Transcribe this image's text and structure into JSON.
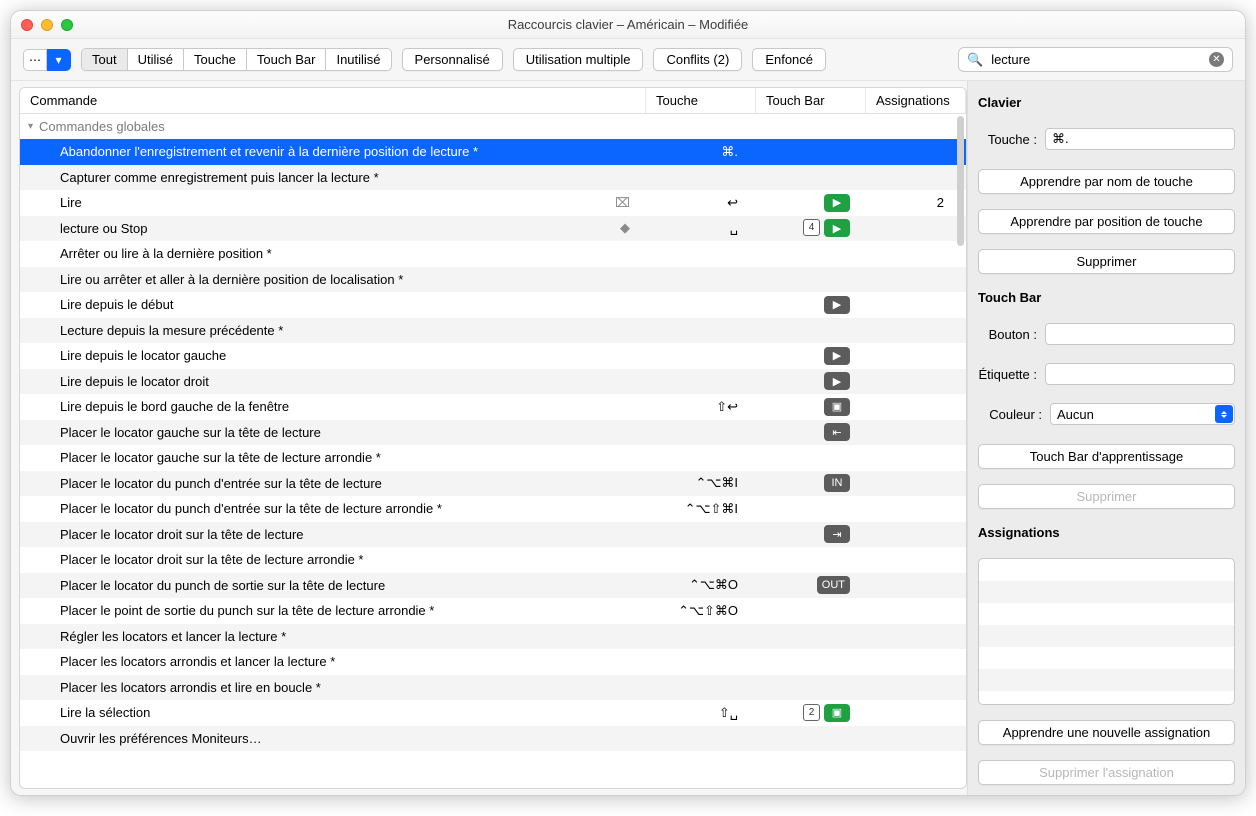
{
  "window": {
    "title": "Raccourcis clavier – Américain – Modifiée"
  },
  "toolbar": {
    "filters": [
      "Tout",
      "Utilisé",
      "Touche",
      "Touch Bar",
      "Inutilisé"
    ],
    "active_filter": 0,
    "buttons": {
      "customized": "Personnalisé",
      "multiuse": "Utilisation multiple",
      "conflicts": "Conflits (2)",
      "pressed": "Enfoncé"
    }
  },
  "search": {
    "placeholder": "",
    "value": "lecture"
  },
  "columns": {
    "command": "Commande",
    "key": "Touche",
    "touchbar": "Touch Bar",
    "assignments": "Assignations"
  },
  "group": "Commandes globales",
  "rows": [
    {
      "name": "Abandonner l'enregistrement et revenir à la dernière position de lecture *",
      "key": "⌘.",
      "tb": [],
      "asg": "",
      "selected": true
    },
    {
      "name": "Capturer comme enregistrement puis lancer la lecture *",
      "key": "",
      "tb": [],
      "asg": ""
    },
    {
      "name": "Lire",
      "extra_glyphs": [
        "⌧"
      ],
      "key": "↩",
      "tb": [
        {
          "t": "play"
        }
      ],
      "asg": "2"
    },
    {
      "name": "lecture ou Stop",
      "extra_glyphs": [
        "◆"
      ],
      "key": "␣",
      "tb": [
        {
          "t": "num",
          "v": "4"
        },
        {
          "t": "play"
        }
      ],
      "asg": ""
    },
    {
      "name": "Arrêter ou lire à la dernière position *",
      "key": "",
      "tb": [],
      "asg": ""
    },
    {
      "name": "Lire ou arrêter et aller à la dernière position de localisation *",
      "key": "",
      "tb": [],
      "asg": ""
    },
    {
      "name": "Lire depuis le début",
      "key": "",
      "tb": [
        {
          "t": "dark",
          "v": "▶"
        }
      ],
      "asg": ""
    },
    {
      "name": "Lecture depuis la mesure précédente *",
      "key": "",
      "tb": [],
      "asg": ""
    },
    {
      "name": "Lire depuis le locator gauche",
      "key": "",
      "tb": [
        {
          "t": "dark",
          "v": "▶"
        }
      ],
      "asg": ""
    },
    {
      "name": "Lire depuis le locator droit",
      "key": "",
      "tb": [
        {
          "t": "dark",
          "v": "▶"
        }
      ],
      "asg": ""
    },
    {
      "name": "Lire depuis le bord gauche de la fenêtre",
      "key": "⇧↩",
      "tb": [
        {
          "t": "dark",
          "v": "▣"
        }
      ],
      "asg": ""
    },
    {
      "name": "Placer le locator gauche sur la tête de lecture",
      "key": "",
      "tb": [
        {
          "t": "dark",
          "v": "⇤"
        }
      ],
      "asg": ""
    },
    {
      "name": "Placer le locator gauche sur la tête de lecture arrondie *",
      "key": "",
      "tb": [],
      "asg": ""
    },
    {
      "name": "Placer le locator du punch d'entrée sur la tête de lecture",
      "key": "⌃⌥⌘I",
      "tb": [
        {
          "t": "dark",
          "v": "IN"
        }
      ],
      "asg": ""
    },
    {
      "name": "Placer le locator du punch d'entrée sur la tête de lecture arrondie *",
      "key": "⌃⌥⇧⌘I",
      "tb": [],
      "asg": ""
    },
    {
      "name": "Placer le locator droit sur la tête de lecture",
      "key": "",
      "tb": [
        {
          "t": "dark",
          "v": "⇥"
        }
      ],
      "asg": ""
    },
    {
      "name": "Placer le locator droit sur la tête de lecture arrondie *",
      "key": "",
      "tb": [],
      "asg": ""
    },
    {
      "name": "Placer le locator du punch de sortie sur la tête de lecture",
      "key": "⌃⌥⌘O",
      "tb": [
        {
          "t": "dark",
          "v": "OUT"
        }
      ],
      "asg": ""
    },
    {
      "name": "Placer le point de sortie du punch sur la tête de lecture arrondie *",
      "key": "⌃⌥⇧⌘O",
      "tb": [],
      "asg": ""
    },
    {
      "name": "Régler les locators et lancer la lecture *",
      "key": "",
      "tb": [],
      "asg": ""
    },
    {
      "name": "Placer les locators arrondis et lancer la lecture *",
      "key": "",
      "tb": [],
      "asg": ""
    },
    {
      "name": "Placer les locators arrondis et lire en boucle *",
      "key": "",
      "tb": [],
      "asg": ""
    },
    {
      "name": "Lire la sélection",
      "key": "⇧␣",
      "tb": [
        {
          "t": "num",
          "v": "2"
        },
        {
          "t": "play",
          "v": "▣"
        }
      ],
      "asg": ""
    },
    {
      "name": "Ouvrir les préférences Moniteurs…",
      "key": "",
      "tb": [],
      "asg": ""
    }
  ],
  "side": {
    "kb_header": "Clavier",
    "kb_key_label": "Touche :",
    "kb_key_value": "⌘.",
    "learn_name": "Apprendre par nom de touche",
    "learn_pos": "Apprendre par position de touche",
    "delete": "Supprimer",
    "tb_header": "Touch Bar",
    "tb_button_label": "Bouton :",
    "tb_button_value": "",
    "tb_label_label": "Étiquette :",
    "tb_label_value": "",
    "tb_color_label": "Couleur :",
    "tb_color_value": "Aucun",
    "tb_learn": "Touch Bar d'apprentissage",
    "tb_delete": "Supprimer",
    "asg_header": "Assignations",
    "asg_learn": "Apprendre une nouvelle assignation",
    "asg_delete": "Supprimer l'assignation"
  }
}
